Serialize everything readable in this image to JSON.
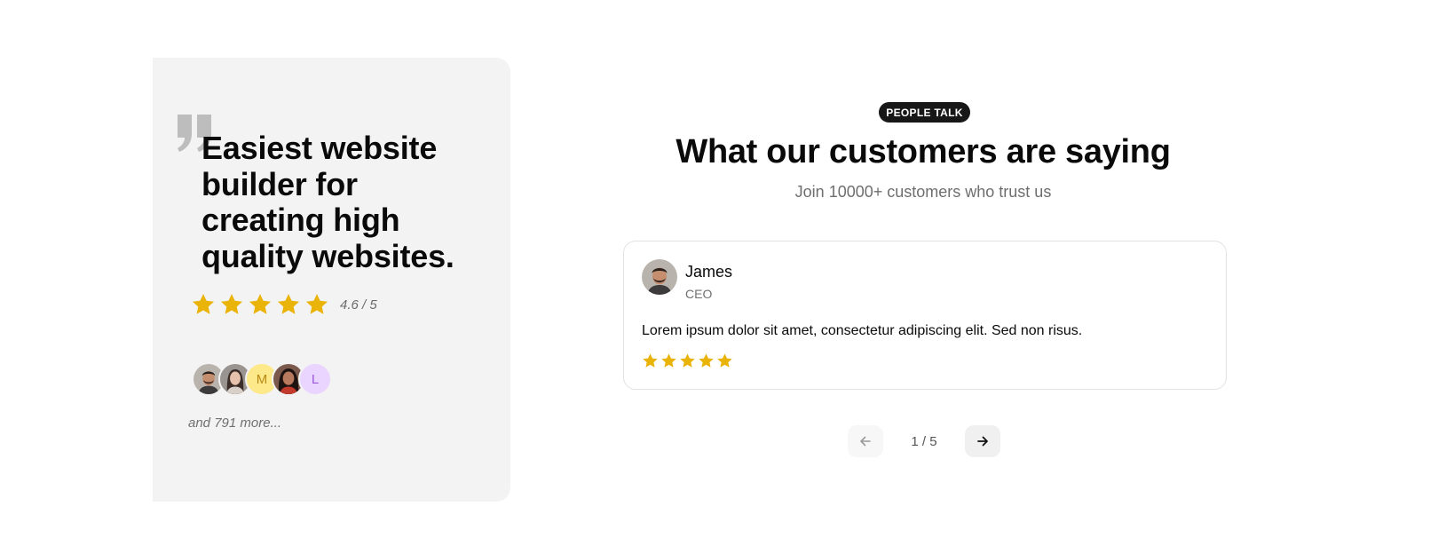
{
  "feature": {
    "headline": "Easiest website builder for creating high quality websites.",
    "rating_text": "4.6 / 5",
    "avatars": [
      {
        "type": "photo",
        "icon": "man-avatar-icon"
      },
      {
        "type": "photo",
        "icon": "woman-avatar-icon"
      },
      {
        "type": "initial",
        "text": "M"
      },
      {
        "type": "photo",
        "icon": "woman-avatar-icon"
      },
      {
        "type": "initial",
        "text": "L"
      }
    ],
    "more_text": "and 791 more..."
  },
  "section": {
    "badge": "PEOPLE TALK",
    "title": "What our customers are saying",
    "subtitle": "Join 10000+ customers who trust us"
  },
  "testimonial": {
    "name": "James",
    "role": "CEO",
    "text": "Lorem ipsum dolor sit amet, consectetur adipiscing elit. Sed non risus.",
    "stars": 5
  },
  "pager": {
    "label": "1 / 5"
  },
  "colors": {
    "star": "#eab308",
    "card_bg": "#f3f3f3",
    "badge_bg": "#171717"
  }
}
